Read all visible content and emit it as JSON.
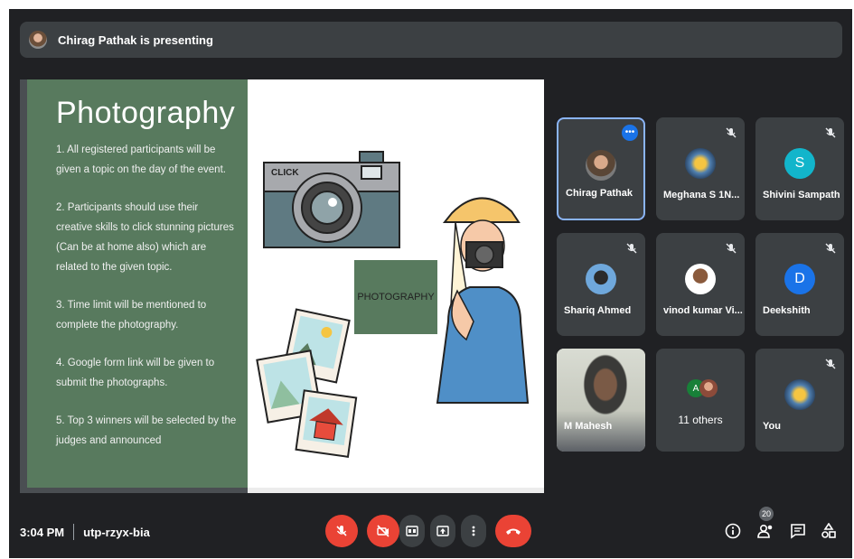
{
  "presenter_banner": {
    "text": "Chirag Pathak is presenting"
  },
  "slide": {
    "title": "Photography",
    "rules": [
      "1. All registered participants will be given a topic on the day of the event.",
      "2. Participants should use their creative skills to click stunning pictures (Can be at home also) which are related to the given topic.",
      "3. Time limit will be mentioned to complete the photography.",
      "4. Google form link will be given to submit the photographs.",
      "5. Top 3 winners will be selected by the judges and announced"
    ],
    "camera_label": "CLICK",
    "photo_label": "PHOTOGRAPHY"
  },
  "participants": [
    {
      "name": "Chirag Pathak",
      "initial": "",
      "active": true
    },
    {
      "name": "Meghana S 1N...",
      "initial": "",
      "muted": true
    },
    {
      "name": "Shivini Sampath",
      "initial": "S",
      "muted": true,
      "color": "#12b5cb"
    },
    {
      "name": "Shariq Ahmed",
      "initial": "",
      "muted": true
    },
    {
      "name": "vinod kumar Vi...",
      "initial": "",
      "muted": true
    },
    {
      "name": "Deekshith",
      "initial": "D",
      "muted": true,
      "color": "#1a73e8"
    },
    {
      "name": "M Mahesh",
      "initial": ""
    },
    {
      "name": "11 others",
      "initial": "A"
    },
    {
      "name": "You",
      "initial": "",
      "muted": true
    }
  ],
  "meeting": {
    "time": "3:04 PM",
    "code": "utp-rzyx-bia"
  },
  "controls": {
    "people_count": "20"
  },
  "colors": {
    "background": "#202124",
    "tile": "#3c4043",
    "accent_red": "#ea4335",
    "accent_blue": "#1a73e8",
    "slide_green": "#587a5e"
  }
}
